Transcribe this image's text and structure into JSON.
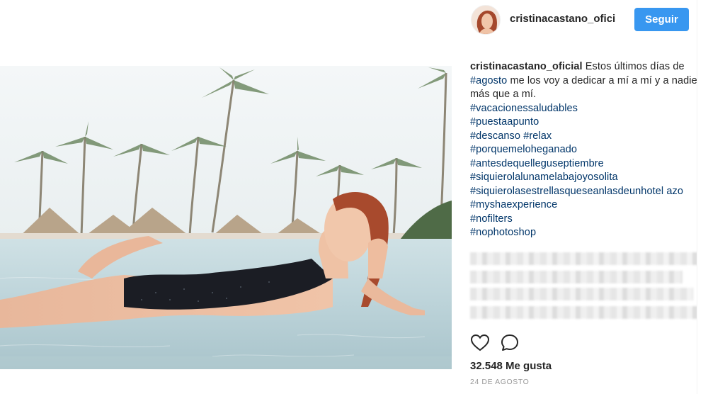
{
  "post": {
    "username": "cristinacastano_oficial",
    "username_header": "cristinacastano_ofici",
    "follow_label": "Seguir",
    "caption": {
      "username": "cristinacastano_oficial",
      "text_part1": " Estos últimos días de ",
      "tag_agosto": "#agosto",
      "text_part2": " me los voy a dedicar a mí a mí y a nadie más que a mí.",
      "tags": [
        "#vacacionessaludables",
        "#puestaapunto",
        "#porquemeloheganado",
        "#antesdequelleguseptiembre",
        "#siquierolalunamelabajoyosolita",
        "#siquierolasestrellasqueseanlasdeunhotel azo",
        "#myshaexperience",
        "#nofilters",
        "#nophotoshop"
      ],
      "tag_descanso": "#descanso",
      "tag_relax": "#relax"
    },
    "likes": "32.548 Me gusta",
    "date": "24 DE AGOSTO",
    "icons": {
      "like": "heart-icon",
      "comment": "comment-icon"
    }
  }
}
